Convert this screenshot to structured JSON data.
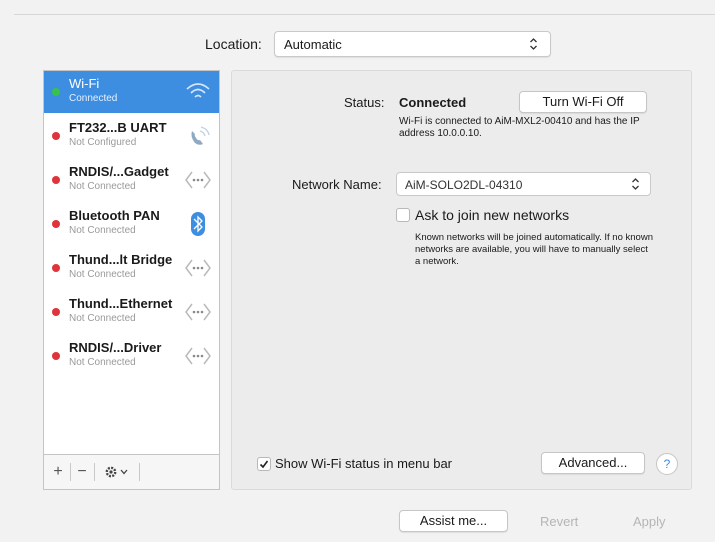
{
  "location": {
    "label": "Location:",
    "value": "Automatic"
  },
  "services": [
    {
      "name": "Wi-Fi",
      "status": "Connected",
      "status_color": "#39c24a",
      "icon": "wifi-icon",
      "selected": true
    },
    {
      "name": "FT232...B UART",
      "status": "Not Configured",
      "status_color": "#e0333a",
      "icon": "phone-icon",
      "selected": false
    },
    {
      "name": "RNDIS/...Gadget",
      "status": "Not Connected",
      "status_color": "#e0333a",
      "icon": "ethernet-arrows-icon",
      "selected": false
    },
    {
      "name": "Bluetooth PAN",
      "status": "Not Connected",
      "status_color": "#e0333a",
      "icon": "bluetooth-icon",
      "selected": false
    },
    {
      "name": "Thund...lt Bridge",
      "status": "Not Connected",
      "status_color": "#e0333a",
      "icon": "ethernet-arrows-icon",
      "selected": false
    },
    {
      "name": "Thund...Ethernet",
      "status": "Not Connected",
      "status_color": "#e0333a",
      "icon": "ethernet-arrows-icon",
      "selected": false
    },
    {
      "name": "RNDIS/...Driver",
      "status": "Not Connected",
      "status_color": "#e0333a",
      "icon": "ethernet-arrows-icon",
      "selected": false
    }
  ],
  "toolbar": {
    "add": "+",
    "remove": "−",
    "gear_icon": "gear-icon"
  },
  "status": {
    "label": "Status:",
    "value": "Connected",
    "button": "Turn Wi-Fi Off",
    "description": "Wi-Fi is connected to AiM-MXL2-00410 and has the IP address 10.0.0.10."
  },
  "network_name": {
    "label": "Network Name:",
    "value": "AiM-SOLO2DL-04310"
  },
  "ask_join": {
    "label": "Ask to join new networks",
    "checked": false,
    "description": "Known networks will be joined automatically. If no known networks are available, you will have to manually select a network."
  },
  "show_status": {
    "label": "Show Wi-Fi status in menu bar",
    "checked": true
  },
  "buttons": {
    "advanced": "Advanced...",
    "help": "?",
    "assist": "Assist me...",
    "revert": "Revert",
    "apply": "Apply"
  },
  "colors": {
    "selection": "#3d8ee0",
    "connected": "#39c24a",
    "disconnected": "#e0333a",
    "disabled_text": "#b5b5b5"
  }
}
